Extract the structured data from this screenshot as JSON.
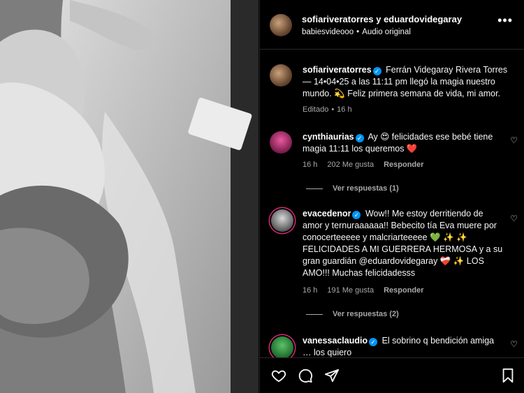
{
  "header": {
    "title": "sofiariveratorres y eduardovidegaray",
    "audio_user": "babiesvideooo",
    "separator": "•",
    "audio_label": "Audio original"
  },
  "caption": {
    "user": "sofiariveratorres",
    "text": "Ferrán Videgaray Rivera Torres — 14•04•25 a las 11:11 pm llegó la magia nuestro mundo. 💫 Feliz primera semana de vida, mi amor.",
    "edited": "Editado",
    "time": "16 h"
  },
  "comments": [
    {
      "user": "cynthiaurias",
      "text": "Ay 😍 felicidades ese bebé tiene magia 11:11 los queremos ❤️",
      "time": "16 h",
      "likes": "202 Me gusta",
      "reply": "Responder",
      "view_replies": "Ver respuestas (1)"
    },
    {
      "user": "evacedenor",
      "text": "Wow!! Me estoy derritiendo de amor y ternuraaaaaa!! Bebecito tía Eva muere por conocerteeeee y malcriarteeeee 💚 ✨ ✨ FELICIDADES A MI GUERRERA HERMOSA y a su gran guardián @eduardovidegaray ❤️‍🩹 ✨ LOS AMO!!! Muchas felicidadesss",
      "time": "16 h",
      "likes": "191 Me gusta",
      "reply": "Responder",
      "view_replies": "Ver respuestas (2)"
    },
    {
      "user": "vanessaclaudio",
      "text": "El sobrino q bendición amiga … los quiero"
    }
  ],
  "icons": {
    "more": "more-options-icon",
    "like": "heart-icon",
    "comment": "comment-icon",
    "share": "share-icon",
    "save": "bookmark-icon",
    "verified": "verified-badge-icon"
  },
  "colors": {
    "verified": "#0095f6",
    "muted": "#a8a8a8",
    "background": "#000000"
  }
}
